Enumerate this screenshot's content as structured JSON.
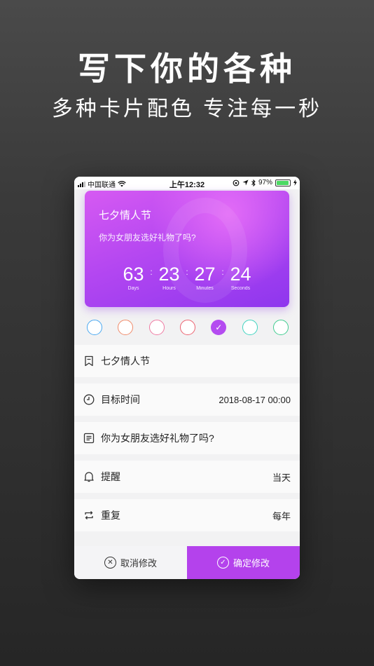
{
  "promo": {
    "headline": "写下你的各种",
    "subline": "多种卡片配色 专注每一秒"
  },
  "statusbar": {
    "carrier": "中国联通",
    "time": "上午12:32",
    "battery": "97%",
    "battery_level": 0.97
  },
  "card": {
    "title": "七夕情人节",
    "description": "你为女朋友选好礼物了吗?",
    "countdown": [
      {
        "value": "63",
        "label": "Days"
      },
      {
        "value": "23",
        "label": "Hours"
      },
      {
        "value": "27",
        "label": "Minutes"
      },
      {
        "value": "24",
        "label": "Seconds"
      }
    ],
    "separator": ":"
  },
  "swatches": [
    {
      "color": "#4aa8f0",
      "selected": false
    },
    {
      "color": "#f08a6a",
      "selected": false
    },
    {
      "color": "#ef7aa2",
      "selected": false
    },
    {
      "color": "#ec6270",
      "selected": false
    },
    {
      "color": "#b44cf0",
      "selected": true,
      "check": "✓"
    },
    {
      "color": "#3fd4c0",
      "selected": false
    },
    {
      "color": "#40cc90",
      "selected": false
    }
  ],
  "form": {
    "title": {
      "value": "七夕情人节",
      "icon": "bookmark-icon"
    },
    "target_time": {
      "label": "目标时间",
      "value": "2018-08-17 00:00",
      "icon": "clock-icon"
    },
    "note": {
      "value": "你为女朋友选好礼物了吗?",
      "icon": "note-icon"
    },
    "reminder": {
      "label": "提醒",
      "value": "当天",
      "icon": "bell-icon"
    },
    "repeat": {
      "label": "重复",
      "value": "每年",
      "icon": "repeat-icon"
    }
  },
  "actions": {
    "cancel_label": "取消修改",
    "cancel_icon": "✕",
    "confirm_label": "确定修改",
    "confirm_icon": "✓",
    "accent": "#b442ec"
  }
}
